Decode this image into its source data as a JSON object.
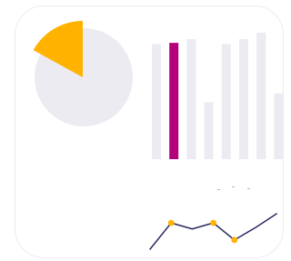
{
  "colors": {
    "pie_background": "#ebebf1",
    "pie_slice": "#ffb300",
    "bar_default": "#ebebf1",
    "bar_highlight": "#b5007b",
    "line": "#2a2a63",
    "marker": "#ffb300"
  },
  "chart_data": [
    {
      "type": "pie",
      "values": [
        0.17,
        0.83
      ],
      "highlighted_index": 0,
      "legend": "none",
      "grid": false
    },
    {
      "type": "bar",
      "values": [
        0.91,
        0.92,
        0.95,
        0.45,
        0.91,
        0.95,
        1.0,
        0.52
      ],
      "highlighted_index": 1,
      "ylim": [
        0,
        1
      ],
      "axes": "hidden",
      "grid": false
    },
    {
      "type": "line",
      "x": [
        0,
        1,
        2,
        3,
        4,
        5,
        6
      ],
      "values": [
        0.0,
        0.74,
        0.57,
        0.74,
        0.26,
        0.61,
        1.0
      ],
      "marker_indices": [
        1,
        3,
        4
      ],
      "ylim": [
        0,
        1
      ],
      "axes": "hidden",
      "grid": false
    }
  ]
}
